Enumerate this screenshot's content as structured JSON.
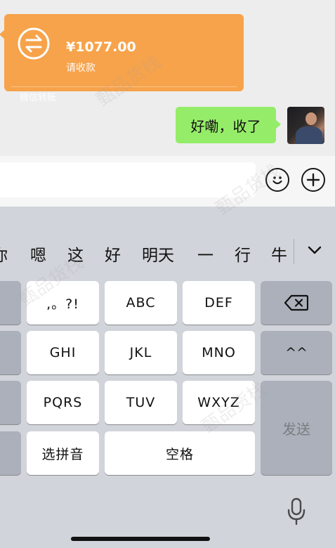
{
  "chat": {
    "transfer": {
      "amount": "¥1077.00",
      "status": "请收款",
      "footer": "微信转账",
      "color": "#f7a34b"
    },
    "my_message": {
      "text": "好嘞，收了",
      "color": "#95ec69"
    }
  },
  "input_bar": {
    "text_value": "",
    "emoji_icon": "smiley-face-icon",
    "more_icon": "plus-circle-icon"
  },
  "keyboard": {
    "candidates": [
      "你",
      "嗯",
      "这",
      "好",
      "明天",
      "一",
      "行",
      "牛"
    ],
    "keys": {
      "punct": ",。?!",
      "abc": "ABC",
      "def": "DEF",
      "ghi": "GHI",
      "jkl": "JKL",
      "mno": "MNO",
      "pqrs": "PQRS",
      "tuv": "TUV",
      "wxyz": "WXYZ",
      "emoticon": "^^",
      "pinyin": "选拼音",
      "space": "空格",
      "send": "发送"
    }
  },
  "watermark": "甄品货栈"
}
